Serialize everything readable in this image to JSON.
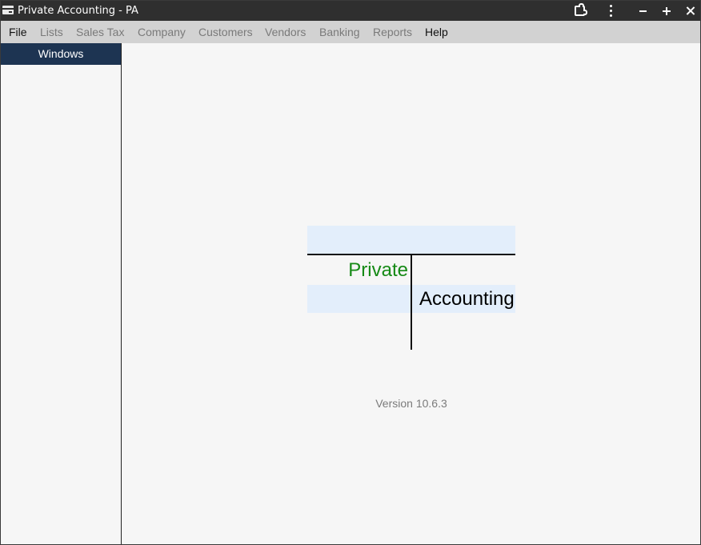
{
  "window": {
    "title": "Private Accounting - PA",
    "controls": {
      "extensions_icon": "puzzle-icon",
      "menu_icon": "kebab-menu-icon",
      "minimize_icon": "minimize-icon",
      "maximize_icon": "plus-icon",
      "close_icon": "close-icon"
    }
  },
  "menubar": {
    "items": [
      {
        "label": "File",
        "enabled": true
      },
      {
        "label": "Lists",
        "enabled": false
      },
      {
        "label": "Sales Tax",
        "enabled": false
      },
      {
        "label": "Company",
        "enabled": false
      },
      {
        "label": "Customers",
        "enabled": false
      },
      {
        "label": "Vendors",
        "enabled": false
      },
      {
        "label": "Banking",
        "enabled": false
      },
      {
        "label": "Reports",
        "enabled": false
      },
      {
        "label": "Help",
        "enabled": true
      }
    ]
  },
  "sidebar": {
    "header": "Windows"
  },
  "logo": {
    "word1": "Private",
    "word2": "Accounting"
  },
  "version": "Version 10.6.3",
  "colors": {
    "titlebar_bg": "#2f2f2f",
    "menubar_bg": "#d2d2d2",
    "sidebar_header_bg": "#1d3452",
    "logo_highlight": "#e3eefb",
    "logo_private": "#168a16",
    "disabled_menu_text": "#7a7a7a"
  }
}
